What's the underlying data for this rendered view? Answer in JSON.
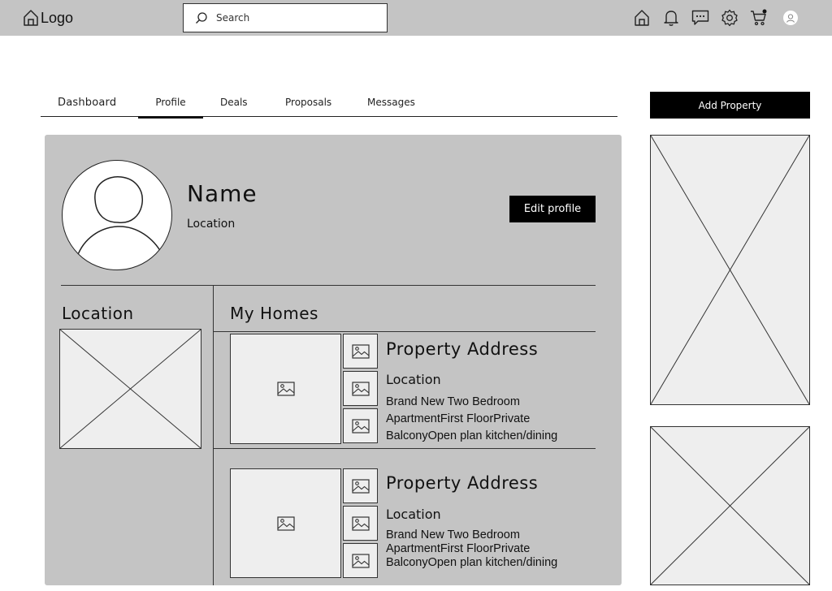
{
  "header": {
    "logo": "Logo",
    "search_placeholder": "Search",
    "icons": [
      "home-icon",
      "bell-icon",
      "chat-icon",
      "gear-icon",
      "cart-icon",
      "user-avatar-icon"
    ]
  },
  "tabs": [
    {
      "label": "Dashboard"
    },
    {
      "label": "Profile",
      "active": true
    },
    {
      "label": "Deals"
    },
    {
      "label": "Proposals"
    },
    {
      "label": "Messages"
    }
  ],
  "profile": {
    "name": "Name",
    "location": "Location",
    "edit_label": "Edit profile"
  },
  "sections": {
    "location_title": "Location",
    "homes_title": "My Homes"
  },
  "homes": [
    {
      "address": "Property Address",
      "location": "Location",
      "description": "Brand New Two Bedroom ApartmentFirst FloorPrivate BalconyOpen plan kitchen/dining"
    },
    {
      "address": "Property Address",
      "location": "Location",
      "description": "Brand New Two Bedroom ApartmentFirst FloorPrivate BalconyOpen plan kitchen/dining"
    }
  ],
  "sidebar": {
    "add_label": "Add Property"
  },
  "colors": {
    "bar": "#c4c4c4",
    "placeholder": "#eeeeee",
    "button": "#000000"
  }
}
